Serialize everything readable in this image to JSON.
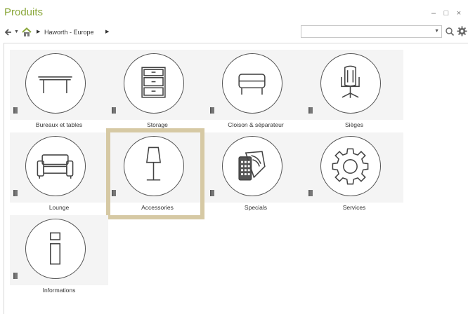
{
  "window": {
    "title": "Produits",
    "controls": {
      "minimize": "–",
      "maximize": "□",
      "close": "×"
    }
  },
  "nav": {
    "back_icon": "arrow-left-icon",
    "home_icon": "home-icon",
    "breadcrumb": "Haworth - Europe",
    "search": {
      "value": "",
      "placeholder": ""
    }
  },
  "accent": {
    "title": "#8aa73a",
    "selection": "#d6c9a4"
  },
  "tiles": [
    {
      "label": "Bureaux et tables",
      "icon": "table-icon"
    },
    {
      "label": "Storage",
      "icon": "cabinet-icon"
    },
    {
      "label": "Cloison & séparateur",
      "icon": "partition-icon"
    },
    {
      "label": "Sièges",
      "icon": "office-chair-icon"
    },
    {
      "label": "Lounge",
      "icon": "sofa-icon"
    },
    {
      "label": "Accessories",
      "icon": "floor-lamp-icon",
      "selected": true
    },
    {
      "label": "Specials",
      "icon": "fabric-swatch-icon"
    },
    {
      "label": "Services",
      "icon": "cog-icon"
    },
    {
      "label": "Informations",
      "icon": "info-icon"
    }
  ]
}
